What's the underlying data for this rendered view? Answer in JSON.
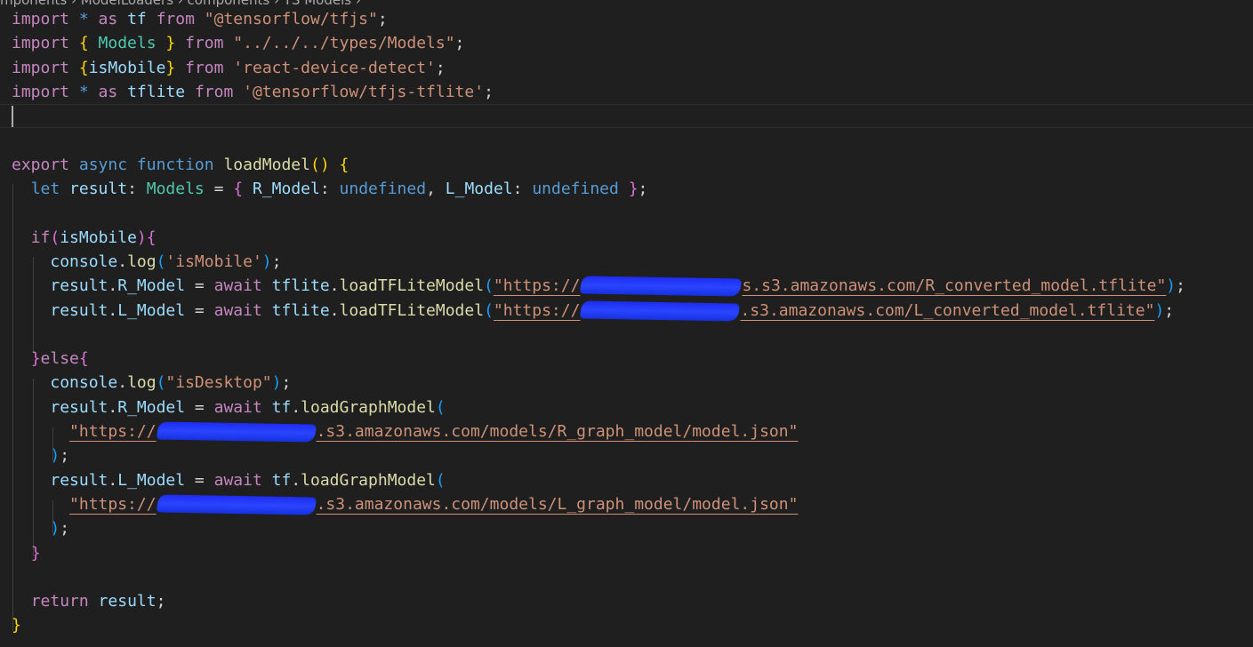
{
  "breadcrumb": "mponents › ModelLoaders › components › TS Models ›",
  "code": {
    "l1": {
      "kw": "import",
      "star": " * ",
      "as": "as",
      "tf": " tf ",
      "from": "from",
      "src": " \"@tensorflow/tfjs\"",
      "semi": ";"
    },
    "l2": {
      "kw": "import",
      "ob": " { ",
      "name": "Models",
      "cb": " } ",
      "from": "from",
      "src": " \"../../../types/Models\"",
      "semi": ";"
    },
    "l3": {
      "kw": "import",
      "ob": " {",
      "name": "isMobile",
      "cb": "} ",
      "from": "from",
      "src": " 'react-device-detect'",
      "semi": ";"
    },
    "l4": {
      "kw": "import",
      "star": " * ",
      "as": "as",
      "tf": " tflite ",
      "from": "from",
      "src": " '@tensorflow/tfjs-tflite'",
      "semi": ";"
    },
    "l7": {
      "export": "export",
      "async": " async",
      "function": " function",
      "fn": " loadModel",
      "parens": "()",
      "brace": " {"
    },
    "l8": {
      "let": "let",
      "result": " result",
      "colon": ": ",
      "type": "Models",
      "eq": " = ",
      "ob": "{ ",
      "k1": "R_Model",
      "c1": ": ",
      "v1": "undefined",
      "comma": ", ",
      "k2": "L_Model",
      "c2": ": ",
      "v2": "undefined",
      "cb": " }",
      "semi": ";"
    },
    "l10": {
      "if": "if",
      "op": "(",
      "cond": "isMobile",
      "cp": ")",
      "ob": "{"
    },
    "l11": {
      "obj": "console",
      "dot": ".",
      "fn": "log",
      "op": "(",
      "str": "'isMobile'",
      "cp": ")",
      "semi": ";"
    },
    "l12": {
      "obj": "result",
      "dot": ".",
      "prop": "R_Model",
      "eq": " = ",
      "await": "await",
      "lib": " tflite",
      "dot2": ".",
      "fn": "loadTFLiteModel",
      "op": "(",
      "s1": "\"https://",
      "s2": "s.s3.amazonaws.com/R_converted_model.tflite\"",
      "cp": ")",
      "semi": ";"
    },
    "l13": {
      "obj": "result",
      "dot": ".",
      "prop": "L_Model",
      "eq": " = ",
      "await": "await",
      "lib": " tflite",
      "dot2": ".",
      "fn": "loadTFLiteModel",
      "op": "(",
      "s1": "\"https://",
      "s2": ".s3.amazonaws.com/L_converted_model.tflite\"",
      "cp": ")",
      "semi": ";"
    },
    "l15": {
      "cb": "}",
      "else": "else",
      "ob": "{"
    },
    "l16": {
      "obj": "console",
      "dot": ".",
      "fn": "log",
      "op": "(",
      "str": "\"isDesktop\"",
      "cp": ")",
      "semi": ";"
    },
    "l17": {
      "obj": "result",
      "dot": ".",
      "prop": "R_Model",
      "eq": " = ",
      "await": "await",
      "lib": " tf",
      "dot2": ".",
      "fn": "loadGraphModel",
      "op": "("
    },
    "l18": {
      "s1": "\"https://",
      "s2": ".s3.amazonaws.com/models/R_graph_model/model.json\""
    },
    "l19": {
      "cp": ")",
      "semi": ";"
    },
    "l20": {
      "obj": "result",
      "dot": ".",
      "prop": "L_Model",
      "eq": " = ",
      "await": "await",
      "lib": " tf",
      "dot2": ".",
      "fn": "loadGraphModel",
      "op": "("
    },
    "l21": {
      "s1": "\"https://",
      "s2": ".s3.amazonaws.com/models/L_graph_model/model.json\""
    },
    "l22": {
      "cp": ")",
      "semi": ";"
    },
    "l23": {
      "cb": "}"
    },
    "l25": {
      "return": "return",
      "result": " result",
      "semi": ";"
    },
    "l26": {
      "cb": "}"
    }
  },
  "colors": {
    "background": "#1f1f1f",
    "keyword": "#c586c0",
    "storage": "#569cd6",
    "variable": "#9cdcfe",
    "function": "#dcdcaa",
    "type": "#4ec9b0",
    "string": "#ce9178",
    "bracket1": "#ffd700",
    "bracket2": "#da70d6",
    "bracket3": "#179fff"
  }
}
